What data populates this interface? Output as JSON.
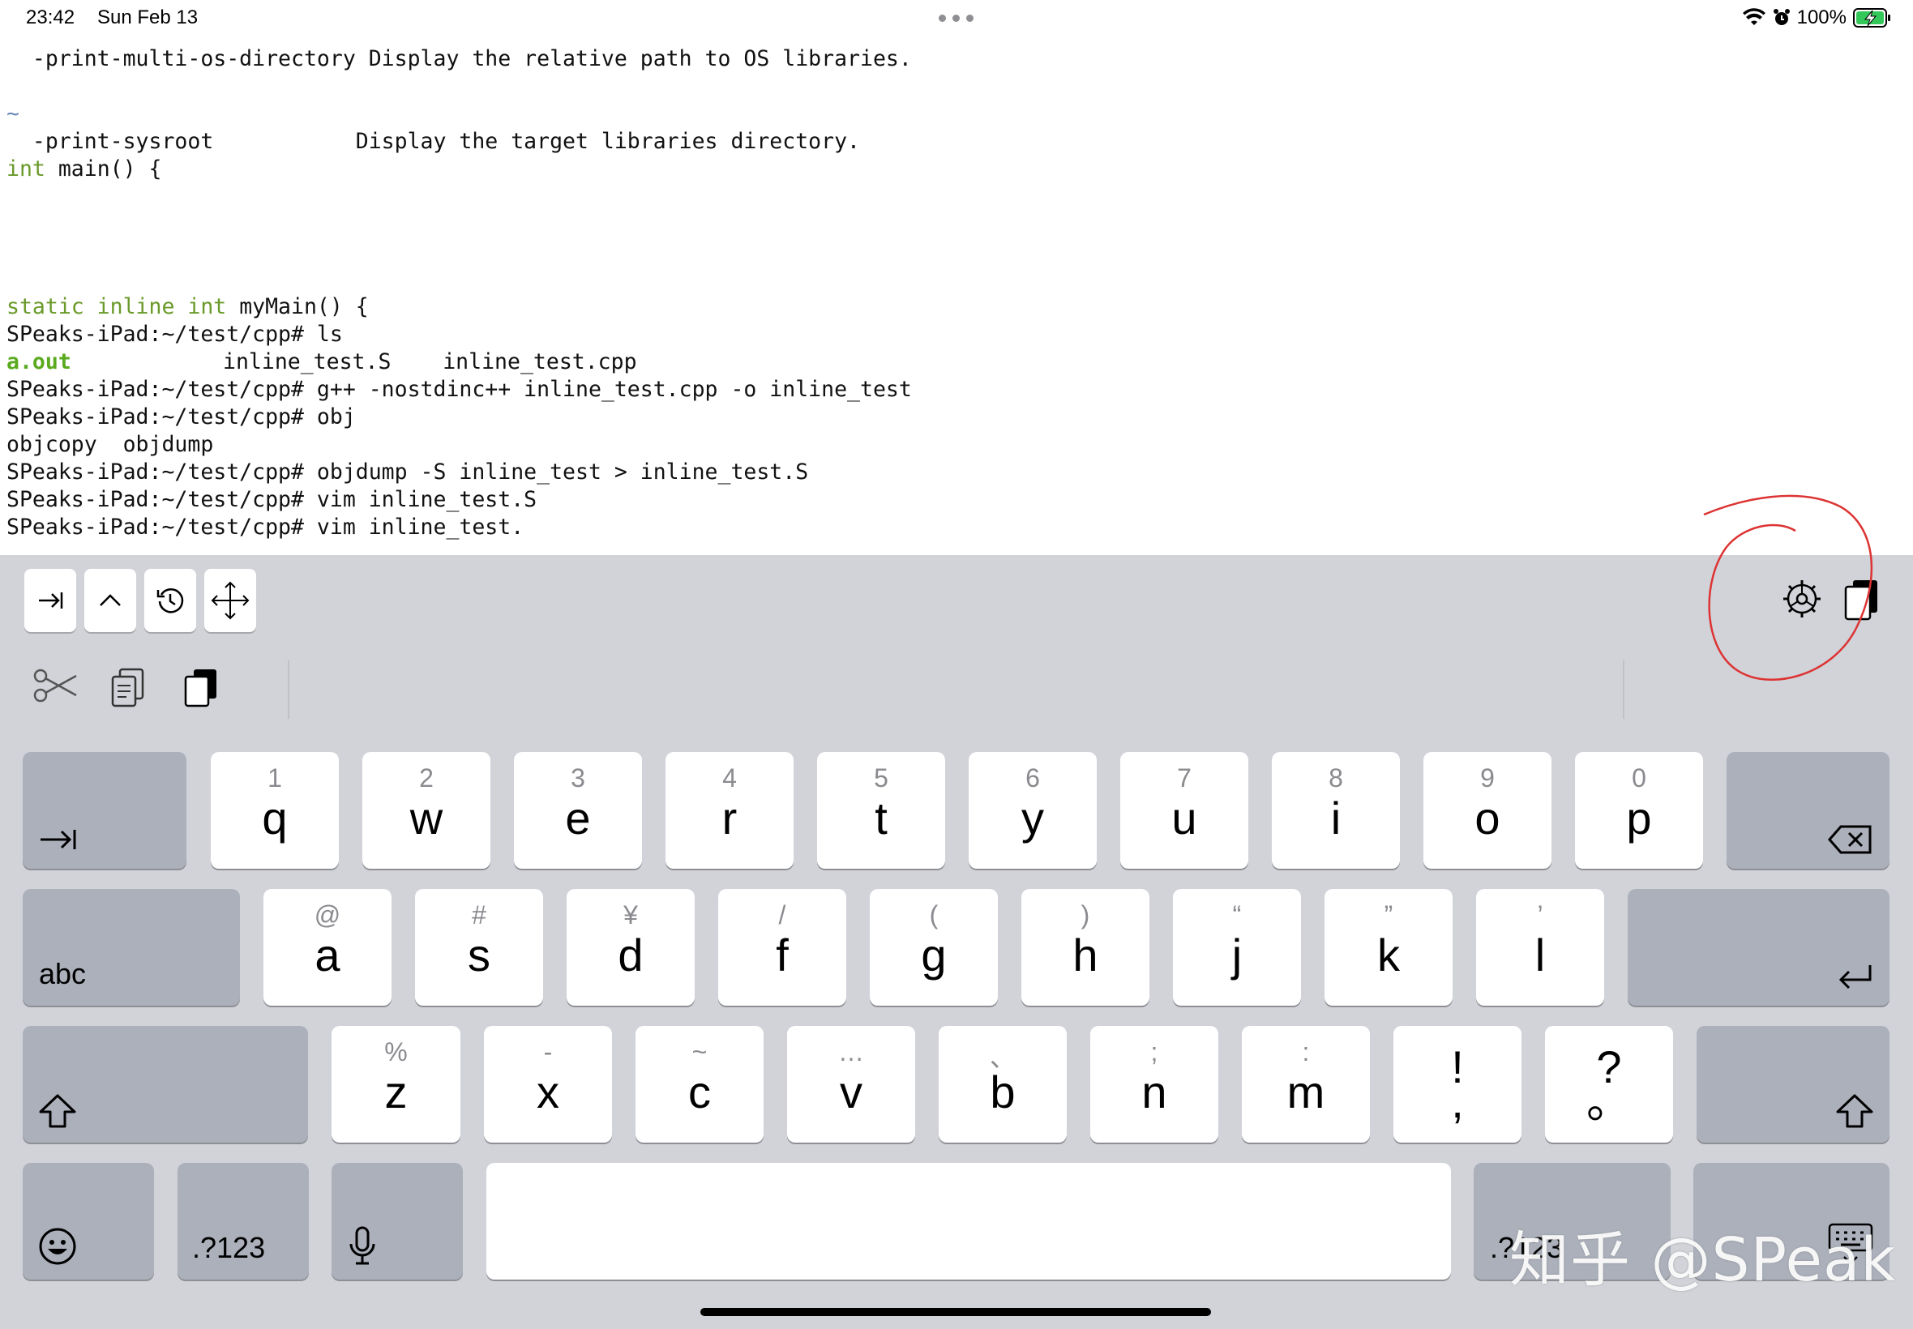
{
  "status": {
    "time": "23:42",
    "date": "Sun Feb 13",
    "battery": "100%"
  },
  "terminal": {
    "lines": [
      "  -print-multi-os-directory Display the relative path to OS libraries.",
      "~",
      "  -print-sysroot           Display the target libraries directory.",
      "main() {",
      "myMain() {",
      "SPeaks-iPad:~/test/cpp# ls",
      "a.out",
      "inline_test.S    inline_test.cpp",
      "SPeaks-iPad:~/test/cpp# g++ -nostdinc++ inline_test.cpp -o inline_test",
      "SPeaks-iPad:~/test/cpp# obj",
      "objcopy  objdump",
      "SPeaks-iPad:~/test/cpp# objdump -S inline_test > inline_test.S",
      "SPeaks-iPad:~/test/cpp# vim inline_test.S",
      "SPeaks-iPad:~/test/cpp# vim inline_test."
    ],
    "kw_int": "int ",
    "kw_static_inline_int": "static inline int "
  },
  "toolbar": {
    "left_icons": [
      "tab-arrow-icon",
      "chevron-up-icon",
      "history-icon",
      "move-arrows-icon"
    ],
    "right_icons": [
      "gear-icon",
      "clipboard-icon"
    ],
    "edit_icons": [
      "scissors-icon",
      "copy-icon",
      "paste-icon"
    ]
  },
  "keyboard": {
    "row1": [
      {
        "sec": "1",
        "pri": "q"
      },
      {
        "sec": "2",
        "pri": "w"
      },
      {
        "sec": "3",
        "pri": "e"
      },
      {
        "sec": "4",
        "pri": "r"
      },
      {
        "sec": "5",
        "pri": "t"
      },
      {
        "sec": "6",
        "pri": "y"
      },
      {
        "sec": "7",
        "pri": "u"
      },
      {
        "sec": "8",
        "pri": "i"
      },
      {
        "sec": "9",
        "pri": "o"
      },
      {
        "sec": "0",
        "pri": "p"
      }
    ],
    "row2": [
      {
        "sec": "@",
        "pri": "a"
      },
      {
        "sec": "#",
        "pri": "s"
      },
      {
        "sec": "¥",
        "pri": "d"
      },
      {
        "sec": "/",
        "pri": "f"
      },
      {
        "sec": "(",
        "pri": "g"
      },
      {
        "sec": ")",
        "pri": "h"
      },
      {
        "sec": "“",
        "pri": "j"
      },
      {
        "sec": "”",
        "pri": "k"
      },
      {
        "sec": "’",
        "pri": "l"
      }
    ],
    "row3": [
      {
        "sec": "%",
        "pri": "z"
      },
      {
        "sec": "-",
        "pri": "x"
      },
      {
        "sec": "~",
        "pri": "c"
      },
      {
        "sec": "…",
        "pri": "v"
      },
      {
        "sec": "、",
        "pri": "b"
      },
      {
        "sec": ";",
        "pri": "n"
      },
      {
        "sec": ":",
        "pri": "m"
      },
      {
        "sec": "!",
        "pri": ","
      },
      {
        "sec": "?",
        "pri": "。"
      }
    ],
    "abc_label": "abc",
    "numbers_label": ".?123",
    "numbers_label_right": ".?123"
  },
  "watermark": "知乎 @SPeak"
}
